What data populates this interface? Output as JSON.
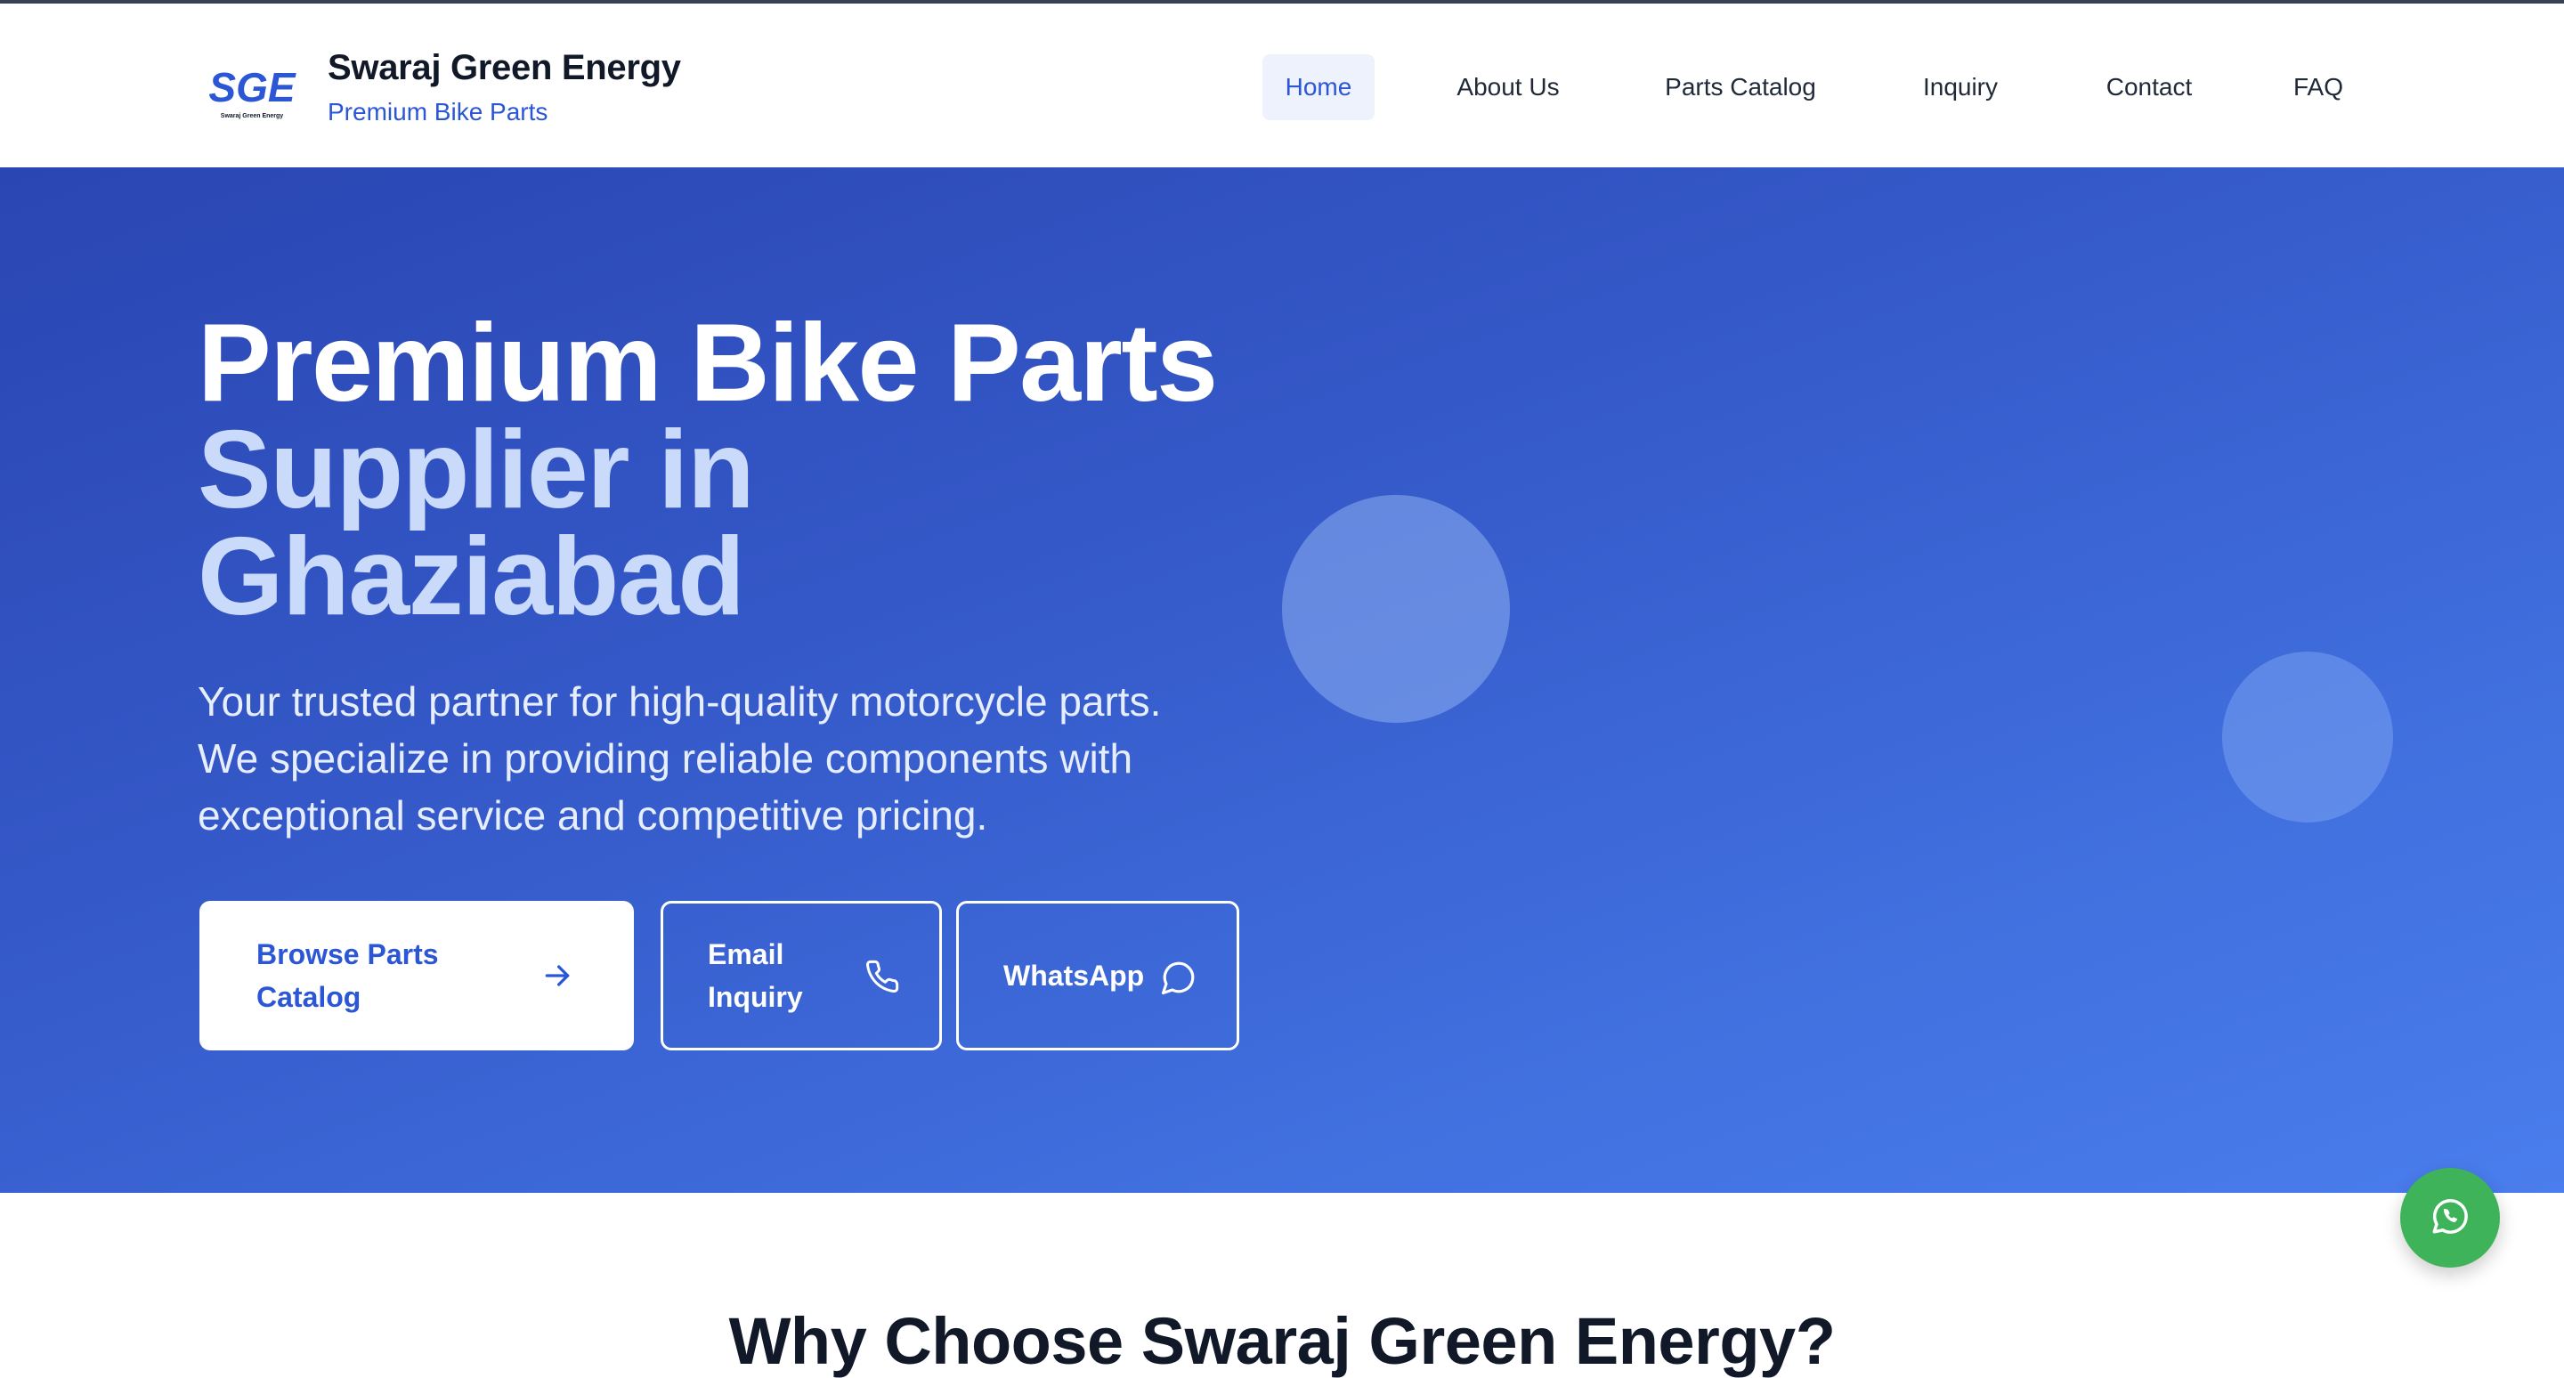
{
  "brand": {
    "logo_text": "SGE",
    "logo_subtext": "Swaraj Green Energy",
    "title": "Swaraj Green Energy",
    "subtitle": "Premium Bike Parts"
  },
  "nav": {
    "items": [
      {
        "label": "Home",
        "active": true
      },
      {
        "label": "About Us"
      },
      {
        "label": "Parts Catalog"
      },
      {
        "label": "Inquiry"
      },
      {
        "label": "Contact"
      },
      {
        "label": "FAQ"
      }
    ]
  },
  "hero": {
    "title_line1": "Premium Bike Parts",
    "title_line2a": "Supplier in",
    "title_line2b": "Ghaziabad",
    "description": "Your trusted partner for high-quality motorcycle parts. We specialize in providing reliable components with exceptional service and competitive pricing.",
    "buttons": {
      "browse": "Browse Parts Catalog",
      "email": "Email Inquiry",
      "whatsapp": "WhatsApp"
    }
  },
  "section": {
    "why_title": "Why Choose Swaraj Green Energy?"
  },
  "icons": {
    "browse": "arrow-right-icon",
    "email": "phone-icon",
    "whatsapp": "chat-bubble-icon",
    "fab": "whatsapp-icon"
  },
  "colors": {
    "accent": "#2b56d6",
    "hero_start": "#2a46b2",
    "hero_end": "#4a7ded",
    "whatsapp": "#3fb35a"
  }
}
